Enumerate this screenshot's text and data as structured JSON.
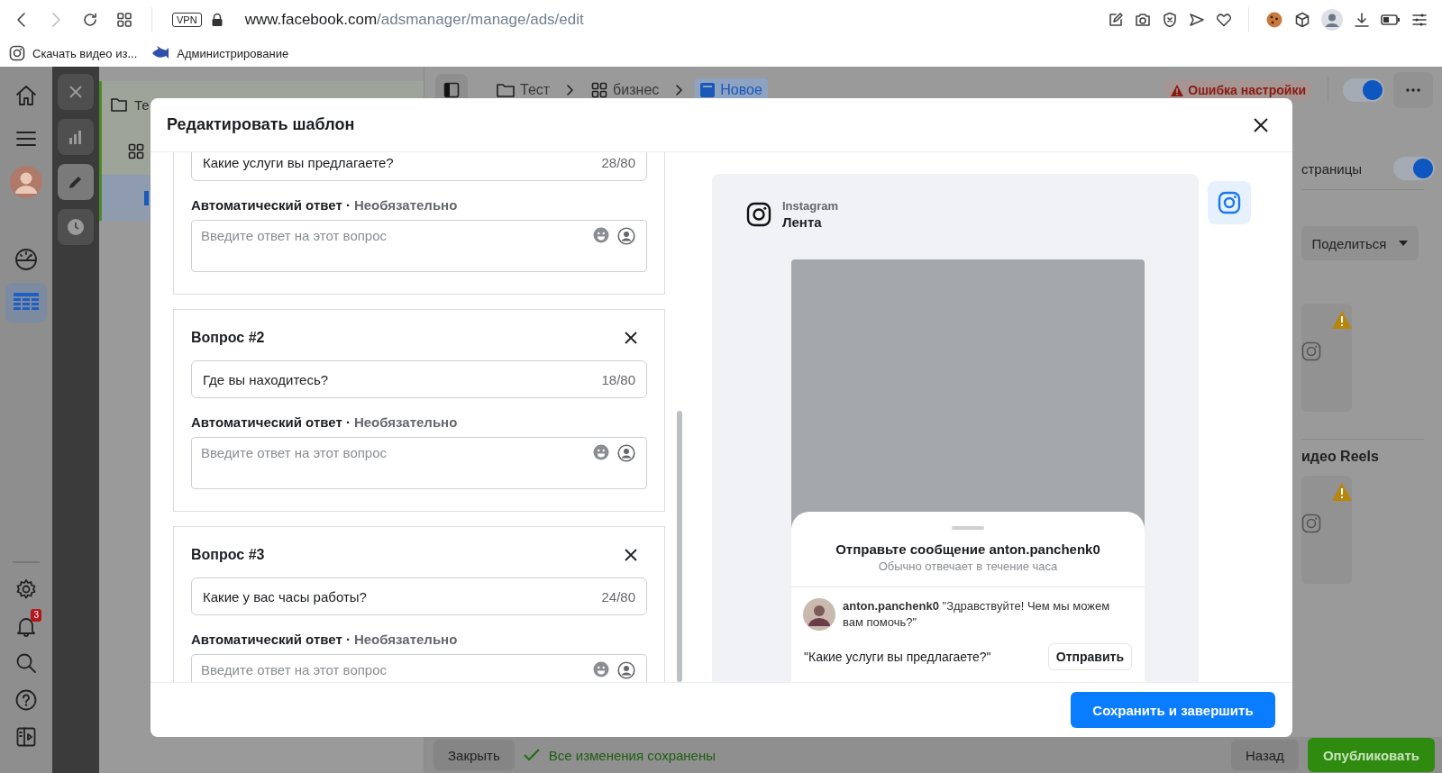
{
  "browser": {
    "url": {
      "host": "www.facebook.com",
      "path": "/adsmanager/manage/ads/edit"
    },
    "vpn_badge": "VPN",
    "bookmarks": [
      {
        "label": "Скачать видео из..."
      },
      {
        "label": "Администрирование"
      }
    ]
  },
  "nav": {
    "top": [
      {
        "kind": "home",
        "selected": false
      },
      {
        "kind": "menu",
        "selected": false
      },
      {
        "kind": "profile",
        "selected": false
      },
      {
        "kind": "gauge",
        "selected": false
      },
      {
        "kind": "table",
        "selected": true
      }
    ],
    "bottom": [
      {
        "kind": "settings"
      },
      {
        "kind": "notifications",
        "badge": "3"
      },
      {
        "kind": "search"
      },
      {
        "kind": "help"
      },
      {
        "kind": "panel"
      }
    ]
  },
  "tools": [
    {
      "kind": "close",
      "selected": false
    },
    {
      "kind": "chart",
      "selected": false
    },
    {
      "kind": "edit",
      "selected": true
    },
    {
      "kind": "history",
      "selected": false
    }
  ],
  "side_panel": {
    "folder_label": "Те"
  },
  "breadcrumbs": [
    {
      "label": "Тест",
      "kind": "folder",
      "selected": false
    },
    {
      "label": "бизнес",
      "kind": "grid",
      "selected": false
    },
    {
      "label": "Новое",
      "kind": "page",
      "selected": true
    }
  ],
  "top_status": {
    "error": "Ошибка настройки",
    "toggle_on": true
  },
  "right_panel": {
    "section_label": "страницы",
    "toggle_on": true,
    "share": "Поделиться",
    "section2_label": "идео Reels"
  },
  "bottom_bar": {
    "close": "Закрыть",
    "saved": "Все изменения сохранены",
    "back": "Назад",
    "publish": "Опубликовать"
  },
  "modal": {
    "title": "Редактировать шаблон",
    "questions": [
      {
        "question": "Какие услуги вы предлагаете?",
        "counter": "28/80",
        "answer_label": "Автоматический ответ ·",
        "optional": "Необязательно",
        "placeholder": "Введите ответ на этот вопрос"
      },
      {
        "title": "Вопрос #2",
        "question": "Где вы находитесь?",
        "counter": "18/80",
        "answer_label": "Автоматический ответ ·",
        "optional": "Необязательно",
        "placeholder": "Введите ответ на этот вопрос"
      },
      {
        "title": "Вопрос #3",
        "question": "Какие у вас часы работы?",
        "counter": "24/80",
        "answer_label": "Автоматический ответ ·",
        "optional": "Необязательно",
        "placeholder": "Введите ответ на этот вопрос"
      }
    ],
    "preview": {
      "platform": "Instagram",
      "placement": "Лента",
      "sheet_title": "Отправьте сообщение anton.panchenk0",
      "sheet_subtitle": "Обычно отвечает в течение часа",
      "greeting": "**anton.panchenk0** \"Здравствуйте! Чем мы можем вам помочь?\"",
      "quick_reply": "\"Какие услуги вы предлагаете?\"",
      "send": "Отправить"
    },
    "save": "Сохранить и завершить"
  }
}
